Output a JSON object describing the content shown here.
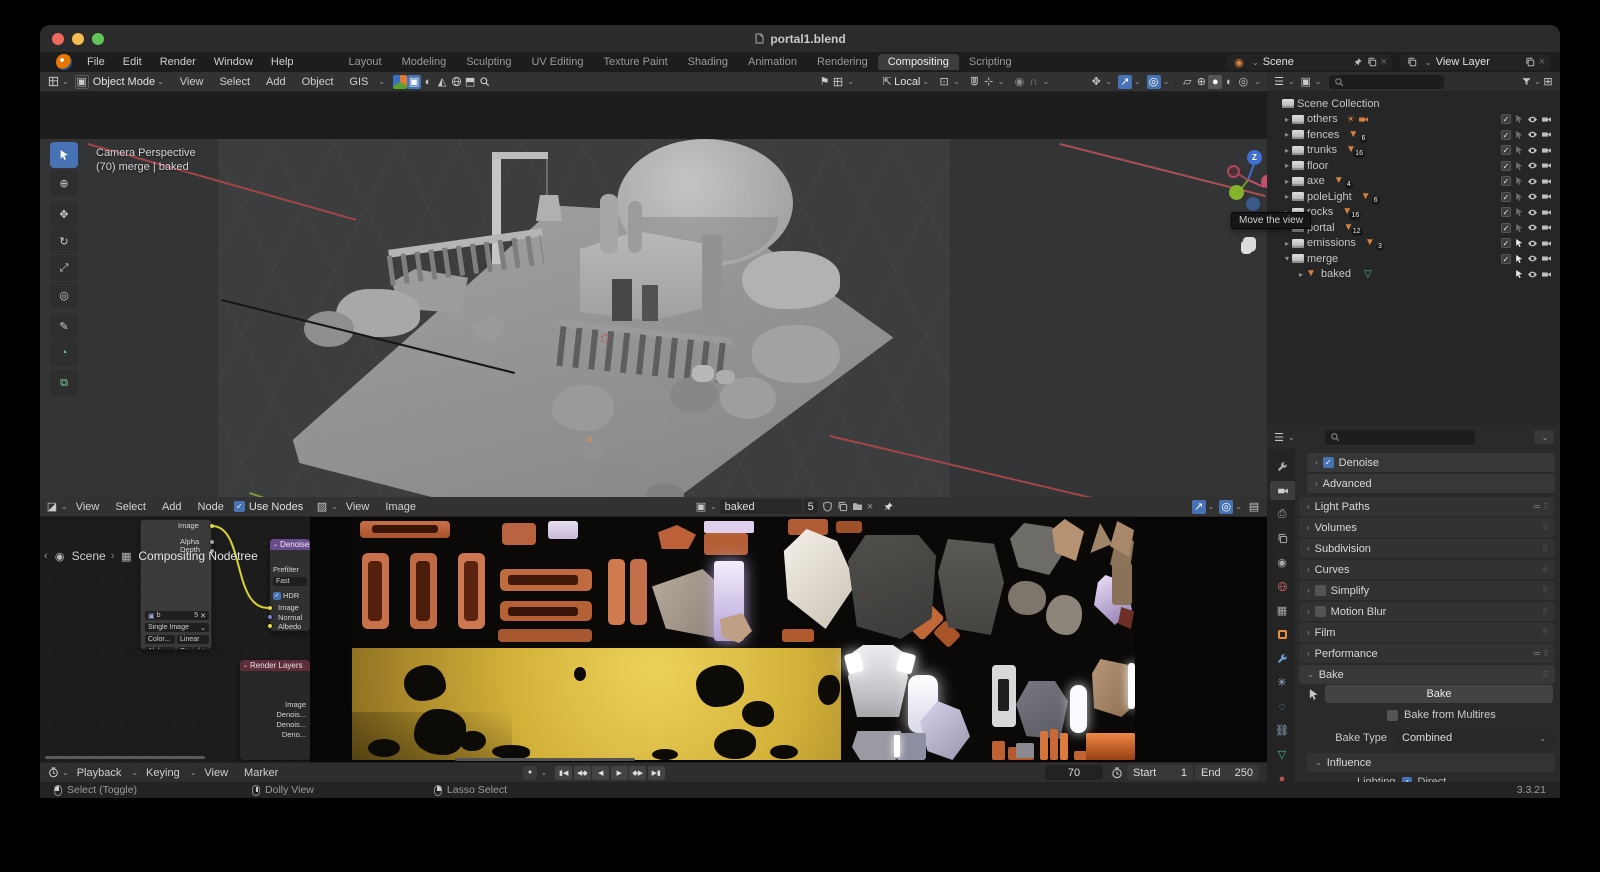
{
  "window": {
    "title": "portal1.blend"
  },
  "colors": {
    "accent_blue": "#4772b3",
    "object_orange": "#e8913e",
    "mesh_icon_orange": "#d8813f",
    "mesh_data_green": "#3fbf8f",
    "denoise_header_purple": "#6a4b8e",
    "render_layers_header": "#5d2e3a",
    "wire_yellow": "#d6d232"
  },
  "menubar": {
    "items": [
      "File",
      "Edit",
      "Render",
      "Window",
      "Help"
    ]
  },
  "workspace_tabs": {
    "items": [
      "Layout",
      "Modeling",
      "Sculpting",
      "UV Editing",
      "Texture Paint",
      "Shading",
      "Animation",
      "Rendering",
      "Compositing",
      "Scripting"
    ],
    "active": "Compositing"
  },
  "scene_selector": {
    "value": "Scene"
  },
  "view_layer_selector": {
    "value": "View Layer"
  },
  "viewport": {
    "header": {
      "mode": "Object Mode",
      "menus": [
        "View",
        "Select",
        "Add",
        "Object",
        "GIS"
      ],
      "orientation": "Local"
    },
    "overlay": {
      "line1": "Camera Perspective",
      "line2": "(70) merge | baked"
    },
    "gizmo_axis_label": "Z",
    "tooltip": "Move the view"
  },
  "outliner": {
    "rows": [
      {
        "label": "Scene Collection"
      },
      {
        "label": "others"
      },
      {
        "label": "fences",
        "count": "6"
      },
      {
        "label": "trunks",
        "count": "16"
      },
      {
        "label": "floor"
      },
      {
        "label": "axe",
        "count": "4"
      },
      {
        "label": "poleLight",
        "count": "6"
      },
      {
        "label": "rocks",
        "count": "16"
      },
      {
        "label": "portal",
        "count": "12"
      },
      {
        "label": "emissions",
        "count": "3"
      },
      {
        "label": "merge"
      },
      {
        "label": "baked"
      }
    ]
  },
  "properties": {
    "panels": {
      "denoise": "Denoise",
      "advanced": "Advanced",
      "light_paths": "Light Paths",
      "volumes": "Volumes",
      "subdivision": "Subdivision",
      "curves": "Curves",
      "simplify": "Simplify",
      "motion_blur": "Motion Blur",
      "film": "Film",
      "performance": "Performance",
      "bake": "Bake"
    },
    "bake": {
      "button": "Bake",
      "multires": "Bake from Multires",
      "type_label": "Bake Type",
      "type_value": "Combined",
      "influence": "Influence",
      "partial_label": "Lighting",
      "partial_value": "Direct"
    }
  },
  "node_editor": {
    "menus": [
      "View",
      "Select",
      "Add",
      "Node"
    ],
    "use_nodes": "Use Nodes",
    "breadcrumb": {
      "scene": "Scene",
      "tree": "Compositing Nodetree"
    },
    "image_node": {
      "out_image": "Image",
      "out_alpha": "Alpha",
      "out_depth": "Depth",
      "name": "b",
      "users": "5",
      "source": "Single Image",
      "color_label": "Color...",
      "color_value": "Linear",
      "alpha_label": "Alpha",
      "alpha_value": "Straight"
    },
    "denoise_node": {
      "title": "Denoise",
      "prefilter_label": "Prefilter",
      "prefilter_value": "Fast",
      "hdr": "HDR",
      "in_image": "Image",
      "in_normal": "Normal",
      "in_albedo": "Albedo"
    },
    "render_layers_node": {
      "title": "Render Layers",
      "out1": "Image",
      "out2": "Denois...",
      "out3": "Denois...",
      "out4": "Deno..."
    }
  },
  "image_editor": {
    "menus": [
      "View",
      "Image"
    ],
    "image_name": "baked",
    "users": "5"
  },
  "timeline": {
    "menus": [
      "Playback",
      "Keying",
      "View",
      "Marker"
    ],
    "frame": "70",
    "start_label": "Start",
    "start_value": "1",
    "end_label": "End",
    "end_value": "250"
  },
  "statusbar": {
    "left": "Select (Toggle)",
    "middle": "Dolly View",
    "right": "Lasso Select",
    "version": "3.3.21"
  }
}
